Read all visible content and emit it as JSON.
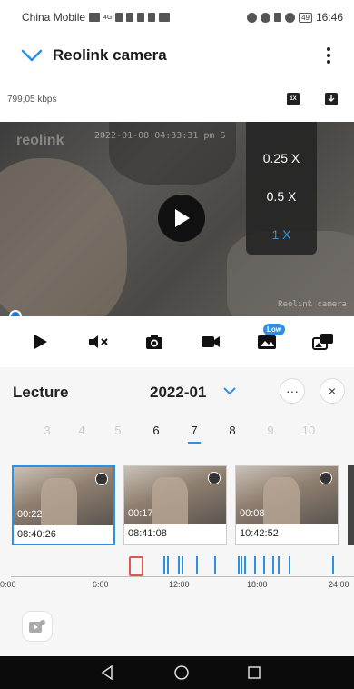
{
  "status_bar": {
    "carrier": "China Mobile",
    "network": "4G",
    "battery": "49",
    "time": "16:46"
  },
  "header": {
    "title": "Reolink camera"
  },
  "info": {
    "bitrate": "799,05 kbps",
    "speed_button": "1X"
  },
  "video": {
    "watermark_logo": "reolink",
    "watermark_time": "2022-01-08 04:33:31 pm S",
    "watermark_name": "Reolink camera",
    "speed_options": [
      {
        "label": "0.25 X",
        "active": false
      },
      {
        "label": "0.5 X",
        "active": false
      },
      {
        "label": "1 X",
        "active": true
      }
    ]
  },
  "toolbar": {
    "low_badge": "Low"
  },
  "panel": {
    "title": "Lecture",
    "month": "2022-01",
    "more_label": "···",
    "close_label": "×",
    "days": [
      "3",
      "4",
      "5",
      "6",
      "7",
      "8",
      "9",
      "10"
    ],
    "days_with_recordings": [
      "6",
      "7",
      "8"
    ],
    "selected_day": "7",
    "clips": [
      {
        "duration": "00:22",
        "time": "08:40:26",
        "selected": true
      },
      {
        "duration": "00:17",
        "time": "08:41:08",
        "selected": false
      },
      {
        "duration": "00:08",
        "time": "10:42:52",
        "selected": false
      }
    ],
    "timeline_labels": [
      "0:00",
      "6:00",
      "12:00",
      "18:00",
      "24:00"
    ]
  },
  "colors": {
    "accent": "#2f8fe0",
    "cursor": "#e25555",
    "navbar": "#0b0b0b"
  }
}
